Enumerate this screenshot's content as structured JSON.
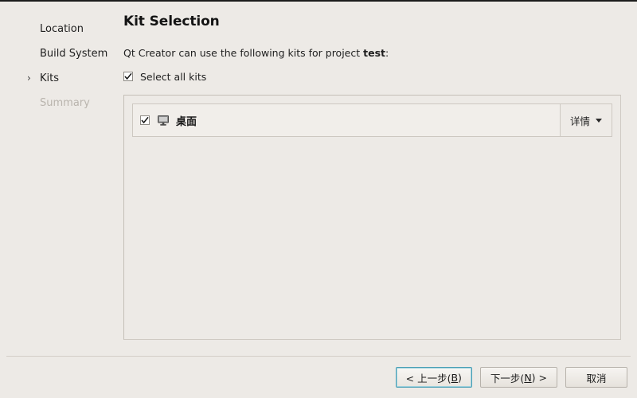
{
  "window": {
    "title": "Kit Selection"
  },
  "sidebar": {
    "items": [
      {
        "label": "Location",
        "state": "done",
        "marker": ""
      },
      {
        "label": "Build System",
        "state": "done",
        "marker": ""
      },
      {
        "label": "Kits",
        "state": "current",
        "marker": "›"
      },
      {
        "label": "Summary",
        "state": "disabled",
        "marker": ""
      }
    ]
  },
  "main": {
    "title": "Kit Selection",
    "intro_prefix": "Qt Creator can use the following kits for project ",
    "intro_project": "test",
    "intro_suffix": ":",
    "select_all_label": "Select all kits",
    "select_all_checked": true,
    "kits": [
      {
        "name": "桌面",
        "checked": true,
        "icon": "desktop-monitor-icon",
        "details_label": "详情"
      }
    ]
  },
  "footer": {
    "back_button": {
      "text_before": "< 上一步(",
      "accel": "B",
      "text_after": ")",
      "focused": true
    },
    "next_button": {
      "text_before": "下一步(",
      "accel": "N",
      "text_after": ") >",
      "focused": false
    },
    "cancel_button": {
      "label": "取消"
    }
  },
  "colors": {
    "background": "#edeae6",
    "panel_border": "#cfcac3",
    "row_background": "#f1eeea",
    "focus_ring": "#4a9fb5",
    "disabled_text": "#b9b4ad",
    "text": "#1f1f1f"
  }
}
